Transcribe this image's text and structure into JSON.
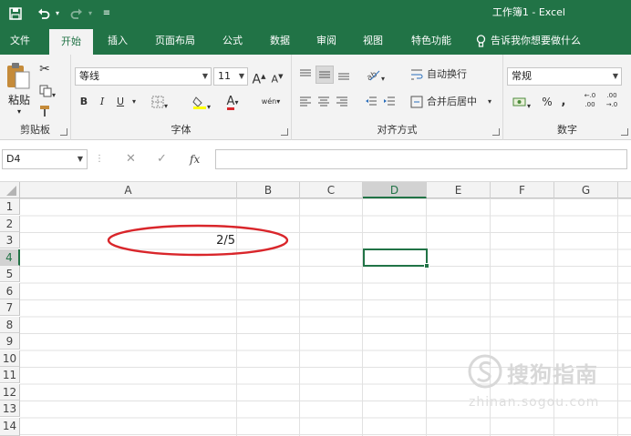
{
  "titlebar": {
    "save_icon": "save-icon",
    "undo_icon": "undo-icon",
    "redo_icon": "redo-icon",
    "doc_title": "工作簿1 - Excel"
  },
  "tabs": [
    {
      "label": "文件"
    },
    {
      "label": "开始"
    },
    {
      "label": "插入"
    },
    {
      "label": "页面布局"
    },
    {
      "label": "公式"
    },
    {
      "label": "数据"
    },
    {
      "label": "审阅"
    },
    {
      "label": "视图"
    },
    {
      "label": "特色功能"
    }
  ],
  "tell_me": "告诉我你想要做什么",
  "ribbon": {
    "clipboard": {
      "paste_label": "粘贴",
      "group_label": "剪贴板"
    },
    "font": {
      "font_name": "等线",
      "font_size": "11",
      "grow": "A",
      "shrink": "A",
      "bold": "B",
      "italic": "I",
      "underline": "U",
      "font_color_letter": "A",
      "phonetic": "wén",
      "group_label": "字体"
    },
    "alignment": {
      "wrap_text": "自动换行",
      "merge_center": "合并后居中",
      "group_label": "对齐方式"
    },
    "number": {
      "format": "常规",
      "percent": "%",
      "comma": ",",
      "inc_decimal_top": "←.0",
      "inc_decimal_bottom": ".00",
      "dec_decimal_top": ".00",
      "dec_decimal_bottom": "→.0",
      "group_label": "数字"
    }
  },
  "formula_bar": {
    "name_box": "D4",
    "cancel": "✕",
    "enter": "✓",
    "fx": "fx",
    "content": ""
  },
  "grid": {
    "columns": [
      "A",
      "B",
      "C",
      "D",
      "E",
      "F",
      "G"
    ],
    "rows": [
      "1",
      "2",
      "3",
      "4",
      "5",
      "6",
      "7",
      "8",
      "9",
      "10",
      "11",
      "12",
      "13",
      "14"
    ],
    "active_cell": "D4",
    "cell_a3": "2/5"
  },
  "watermark": {
    "text": "搜狗指南",
    "url": "zhinan.sogou.com"
  },
  "colors": {
    "excel_green": "#217346",
    "annotation_red": "#d9262b"
  }
}
